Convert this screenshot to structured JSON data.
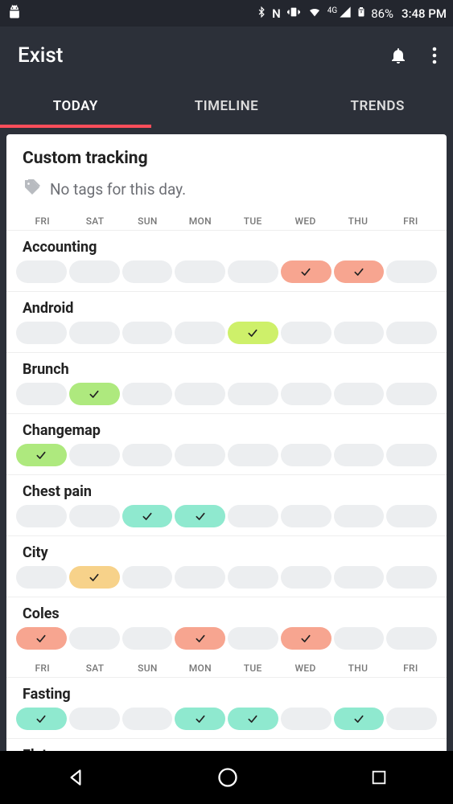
{
  "status": {
    "battery": "86%",
    "clock": "3:48 PM",
    "network_label": "4G"
  },
  "app": {
    "title": "Exist"
  },
  "tabs": [
    {
      "label": "TODAY",
      "active": true
    },
    {
      "label": "TIMELINE",
      "active": false
    },
    {
      "label": "TRENDS",
      "active": false
    }
  ],
  "section": {
    "title": "Custom tracking",
    "no_tags": "No tags for this day."
  },
  "day_labels": [
    "FRI",
    "SAT",
    "SUN",
    "MON",
    "TUE",
    "WED",
    "THU",
    "FRI"
  ],
  "colors": {
    "salmon": "#f7a590",
    "lime": "#cef06a",
    "green": "#aee97e",
    "teal": "#8fe9cf",
    "orange": "#f7d28a",
    "purple": "#c9aef0",
    "empty": "#eceef0"
  },
  "trackers": [
    {
      "name": "Accounting",
      "color": "salmon",
      "days": [
        false,
        false,
        false,
        false,
        false,
        true,
        true,
        false
      ]
    },
    {
      "name": "Android",
      "color": "lime",
      "days": [
        false,
        false,
        false,
        false,
        true,
        false,
        false,
        false
      ]
    },
    {
      "name": "Brunch",
      "color": "green",
      "days": [
        false,
        true,
        false,
        false,
        false,
        false,
        false,
        false
      ]
    },
    {
      "name": "Changemap",
      "color": "green",
      "days": [
        true,
        false,
        false,
        false,
        false,
        false,
        false,
        false
      ]
    },
    {
      "name": "Chest pain",
      "color": "teal",
      "days": [
        false,
        false,
        true,
        true,
        false,
        false,
        false,
        false
      ]
    },
    {
      "name": "City",
      "color": "orange",
      "days": [
        false,
        true,
        false,
        false,
        false,
        false,
        false,
        false
      ]
    },
    {
      "name": "Coles",
      "color": "salmon",
      "days": [
        true,
        false,
        false,
        true,
        false,
        true,
        false,
        false
      ],
      "show_header_after": true
    },
    {
      "name": "Fasting",
      "color": "teal",
      "days": [
        true,
        false,
        false,
        true,
        true,
        false,
        true,
        false
      ]
    },
    {
      "name": "Flat",
      "color": "purple",
      "days": [
        false,
        false,
        false,
        false,
        false,
        true,
        false,
        false
      ]
    }
  ]
}
